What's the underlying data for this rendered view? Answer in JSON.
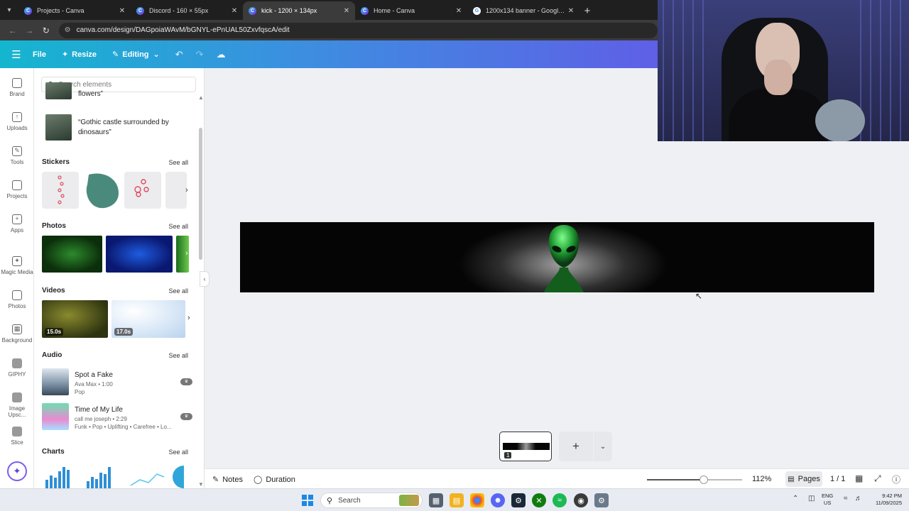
{
  "browser": {
    "tabs": [
      {
        "title": "Projects - Canva",
        "icon": "canva-icon",
        "active": false
      },
      {
        "title": "Discord - 160 × 55px",
        "icon": "canva-icon",
        "active": false
      },
      {
        "title": "kick - 1200 × 134px",
        "icon": "canva-icon",
        "active": true
      },
      {
        "title": "Home - Canva",
        "icon": "canva-icon",
        "active": false
      },
      {
        "title": "1200x134 banner - Google Sea",
        "icon": "google-icon",
        "active": false
      }
    ],
    "url": "canva.com/design/DAGpoiaWAvM/bGNYL-ePnUAL50ZxvfqscA/edit"
  },
  "header": {
    "file_label": "File",
    "resize_label": "Resize",
    "editing_label": "Editing"
  },
  "rail": {
    "items": [
      {
        "label": "Brand",
        "icon": "brand-icon"
      },
      {
        "label": "Uploads",
        "icon": "uploads-icon"
      },
      {
        "label": "Tools",
        "icon": "tools-icon"
      },
      {
        "label": "Projects",
        "icon": "projects-icon"
      },
      {
        "label": "Apps",
        "icon": "apps-icon"
      },
      {
        "label": "Magic Media",
        "icon": "magic-media-icon"
      },
      {
        "label": "Photos",
        "icon": "photos-icon"
      },
      {
        "label": "Background",
        "icon": "background-icon"
      },
      {
        "label": "GIPHY",
        "icon": "giphy-icon"
      },
      {
        "label": "Image Upsc...",
        "icon": "image-upscaler-icon"
      },
      {
        "label": "Slice",
        "icon": "slice-icon"
      }
    ]
  },
  "panel": {
    "search_placeholder": "Search elements",
    "results": [
      {
        "text": "flowers”"
      },
      {
        "text": "“Gothic castle surrounded by dinosaurs”"
      }
    ],
    "sections": {
      "stickers": "Stickers",
      "photos": "Photos",
      "videos": "Videos",
      "audio": "Audio",
      "charts": "Charts"
    },
    "see_all": "See all",
    "videos": [
      {
        "duration": "15.0s"
      },
      {
        "duration": "17.0s"
      }
    ],
    "audio": [
      {
        "name": "Spot a Fake",
        "meta": "Ava Max • 1:00",
        "genre": "Pop"
      },
      {
        "name": "Time of My Life",
        "meta": "call me joseph • 2:29",
        "genre": "Funk • Pop • Uplifting • Carefree • Lo..."
      }
    ]
  },
  "bottombar": {
    "notes_label": "Notes",
    "duration_label": "Duration",
    "zoom": "112%",
    "zoom_fraction": 0.6,
    "pages_label": "Pages",
    "page_count": "1 / 1",
    "page_number": "1"
  },
  "taskbar": {
    "search_label": "Search",
    "lang_line1": "ENG",
    "lang_line2": "US",
    "time": "9:42 PM",
    "date": "11/09/2025"
  },
  "colors": {
    "header_start": "#14b6cf",
    "header_end": "#5f5fe6",
    "alien_green": "#2bd14a"
  }
}
